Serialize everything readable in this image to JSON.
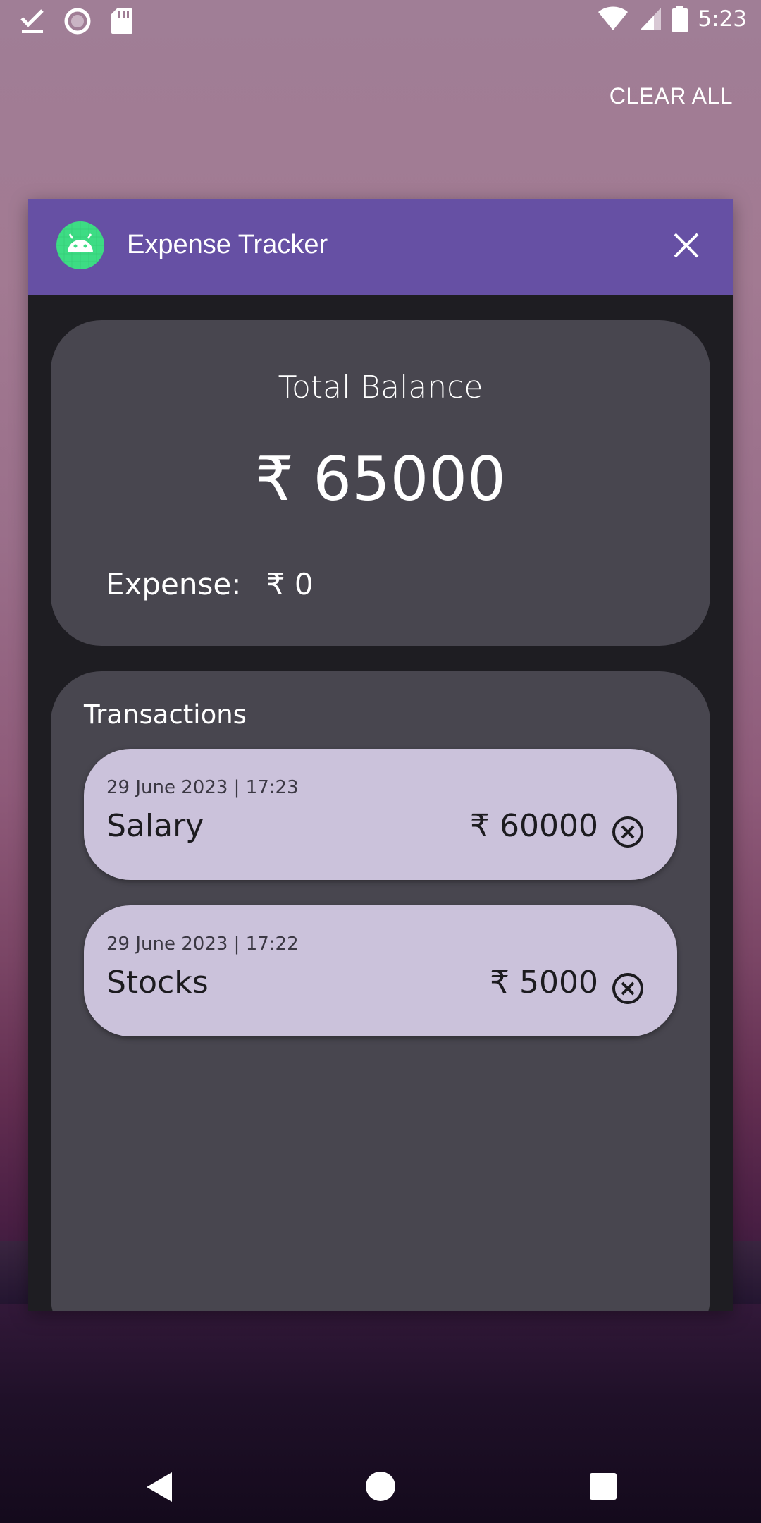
{
  "status_bar": {
    "time": "5:23",
    "left_icons": [
      "checkmark-download-icon",
      "record-icon",
      "sd-card-icon"
    ],
    "right_icons": [
      "wifi-icon",
      "cell-signal-icon",
      "battery-icon"
    ]
  },
  "recents": {
    "clear_all": "CLEAR ALL"
  },
  "app_card": {
    "title": "Expense Tracker",
    "icon": "android-icon",
    "header_color": "#6650a4",
    "balance": {
      "label": "Total Balance",
      "amount": "₹ 65000",
      "expense_label": "Expense:",
      "expense_value": "₹ 0"
    },
    "transactions": {
      "title": "Transactions",
      "items": [
        {
          "date": "29 June 2023 | 17:23",
          "name": "Salary",
          "amount": "₹ 60000"
        },
        {
          "date": "29 June 2023 | 17:22",
          "name": "Stocks",
          "amount": "₹ 5000"
        }
      ]
    }
  },
  "nav_bar": {
    "icons": [
      "back-icon",
      "home-icon",
      "recents-icon"
    ]
  }
}
